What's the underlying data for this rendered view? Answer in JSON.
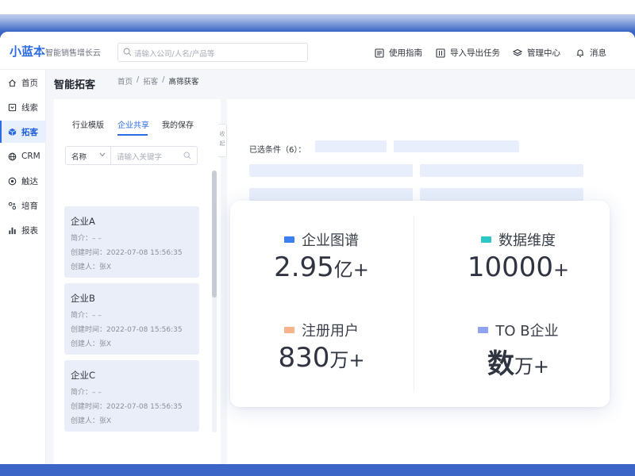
{
  "header": {
    "logo": "小蓝本",
    "slogan": "智能销售增长云",
    "search_placeholder": "请输入公司/人名/产品等",
    "nav": [
      {
        "label": "使用指南",
        "icon": "guide-icon"
      },
      {
        "label": "导入导出任务",
        "icon": "import-export-icon"
      },
      {
        "label": "管理中心",
        "icon": "layers-icon"
      },
      {
        "label": "消息",
        "icon": "bell-icon"
      }
    ]
  },
  "sidebar": {
    "items": [
      {
        "label": "首页",
        "icon": "home-icon"
      },
      {
        "label": "线索",
        "icon": "clue-icon"
      },
      {
        "label": "拓客",
        "icon": "cube-icon",
        "active": true
      },
      {
        "label": "CRM",
        "icon": "globe-icon"
      },
      {
        "label": "触达",
        "icon": "target-icon"
      },
      {
        "label": "培育",
        "icon": "nurture-icon"
      },
      {
        "label": "报表",
        "icon": "bar-chart-icon"
      }
    ]
  },
  "page": {
    "title": "智能拓客",
    "breadcrumb": [
      "首页",
      "/",
      "拓客",
      "/",
      "高筛获客"
    ]
  },
  "panel": {
    "tabs": [
      "行业模版",
      "企业共享",
      "我的保存"
    ],
    "active_tab": "企业共享",
    "filter_select": "名称",
    "filter_placeholder": "请输入关键字",
    "cards": [
      {
        "name": "企业A",
        "intro": "简介：– –",
        "created": "创建时间：2022-07-08 15:56:35",
        "creator": "创建人：张X"
      },
      {
        "name": "企业B",
        "intro": "简介：– –",
        "created": "创建时间：2022-07-08 15:56:35",
        "creator": "创建人：张X"
      },
      {
        "name": "企业C",
        "intro": "简介：– –",
        "created": "创建时间：2022-07-08 15:56:35",
        "creator": "创建人：张X"
      }
    ],
    "toggle_text": "收起"
  },
  "content": {
    "conditions_label": "已选条件（6）："
  },
  "stats": [
    {
      "label": "企业图谱",
      "num": "2.95",
      "unit": "亿+",
      "color": "#3b7ff0"
    },
    {
      "label": "数据维度",
      "num": "10000",
      "unit": "+",
      "color": "#2cc6c4"
    },
    {
      "label": "注册用户",
      "num": "830",
      "unit": "万+",
      "color": "#f7b48b"
    },
    {
      "label": "TO B企业",
      "num": "数",
      "unit": "万+",
      "color": "#8ea3f2"
    }
  ],
  "colors": {
    "accent": "#2d6be4",
    "frame_blue": "#3b66c7",
    "skeleton": "#e8eefb",
    "card_bg": "#e9eef8"
  }
}
